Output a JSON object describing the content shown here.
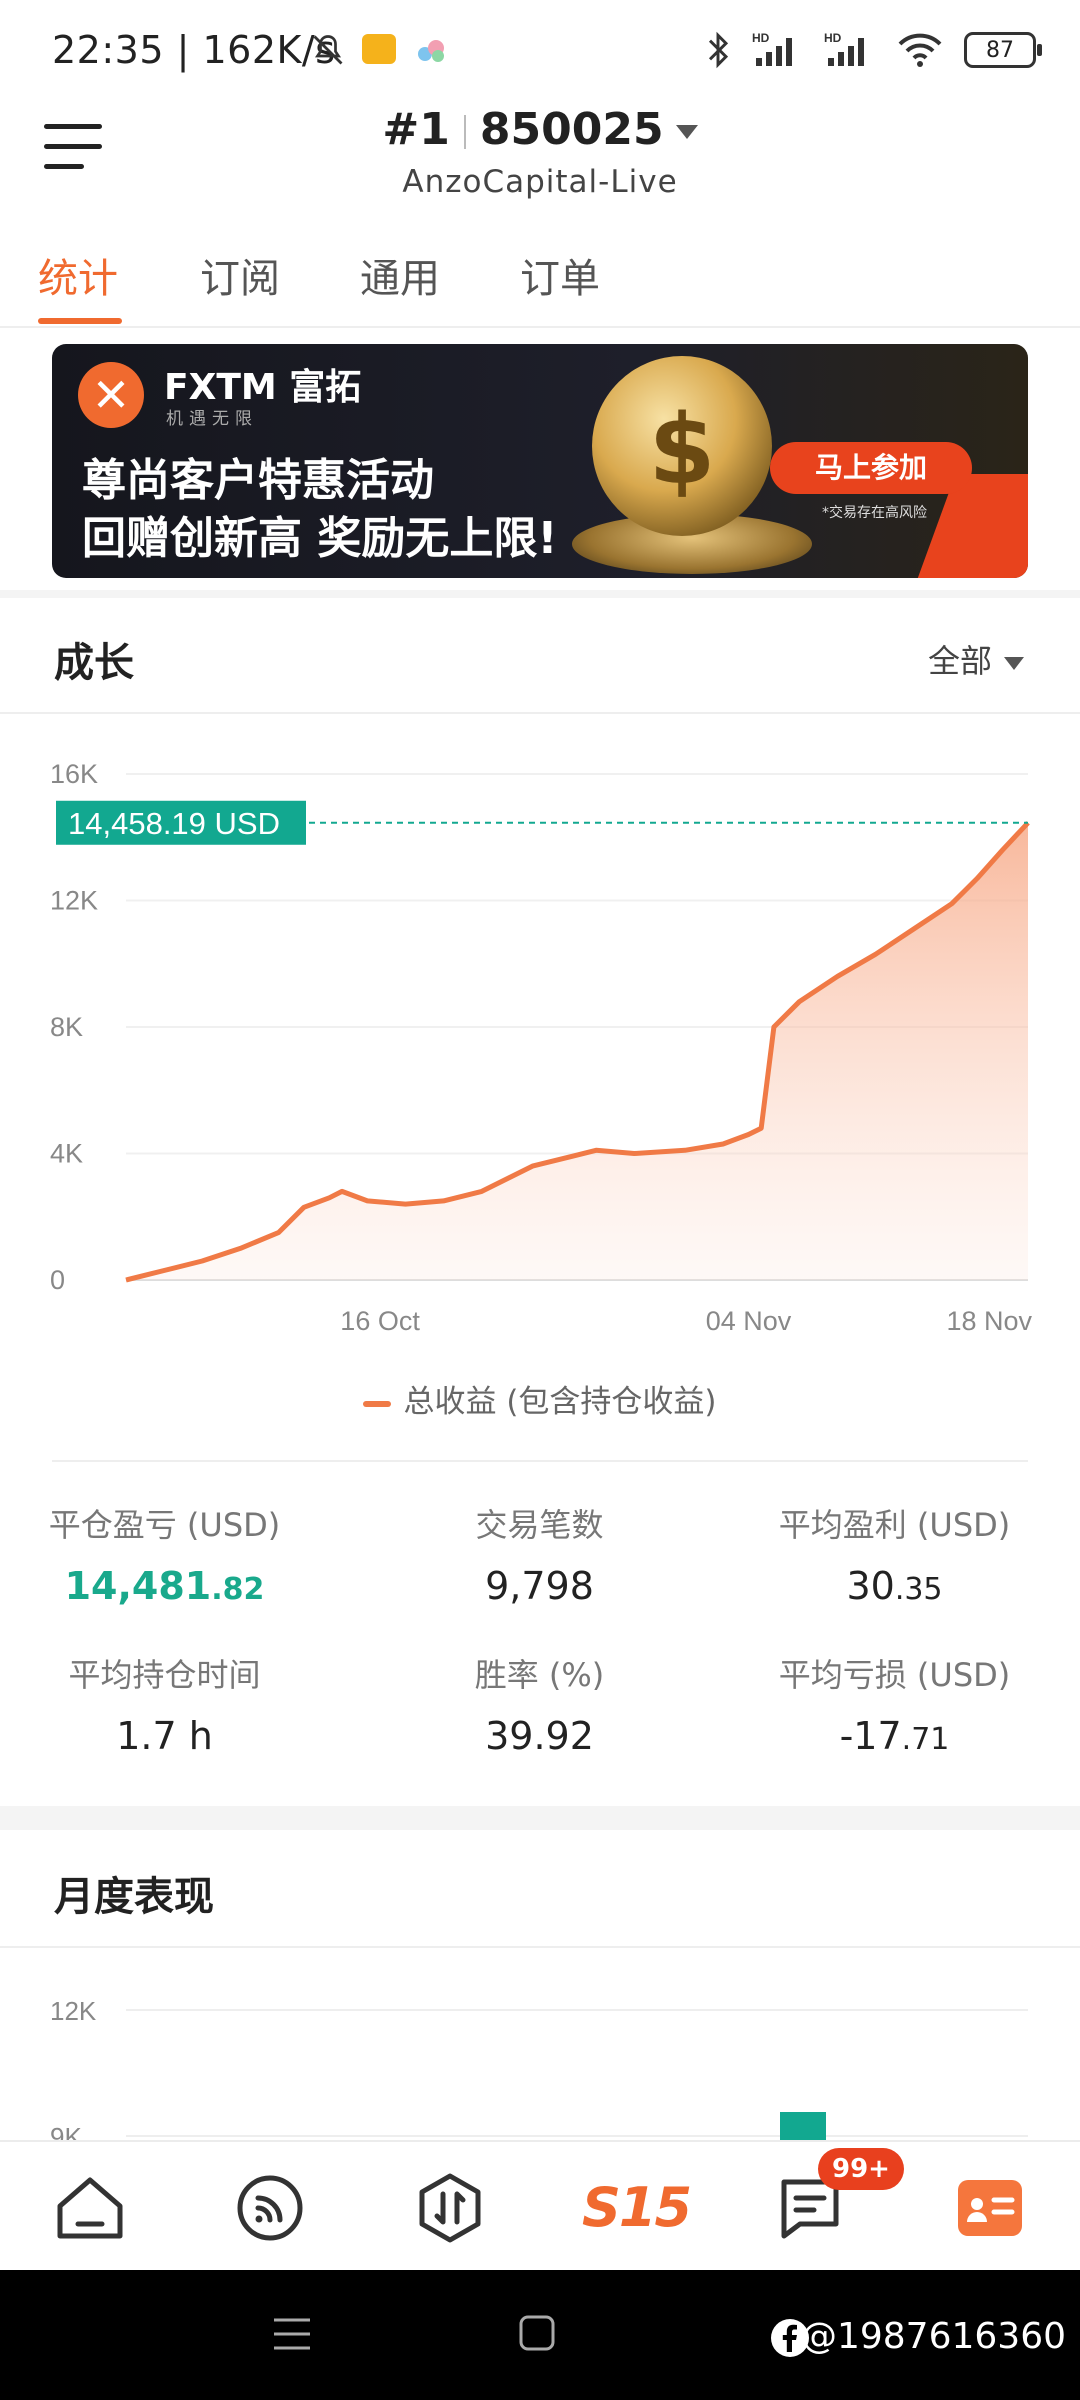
{
  "status_bar": {
    "time": "22:35 | 162K/s",
    "battery": "87"
  },
  "header": {
    "account_rank": "#1",
    "account_id": "850025",
    "server": "AnzoCapital-Live"
  },
  "tabs": [
    {
      "label": "统计",
      "active": true
    },
    {
      "label": "订阅",
      "active": false
    },
    {
      "label": "通用",
      "active": false
    },
    {
      "label": "订单",
      "active": false
    }
  ],
  "banner": {
    "brand": "FXTM 富拓",
    "tagline": "机遇无限",
    "line1": "尊尚客户特惠活动",
    "line2": "回赠创新高 奖励无上限!",
    "cta": "马上参加",
    "risk": "*交易存在高风险"
  },
  "growth": {
    "title": "成长",
    "filter": "全部",
    "current_value_label": "14,458.19 USD",
    "legend": "总收益 (包含持仓收益)"
  },
  "chart_data": [
    {
      "type": "area",
      "title": "成长",
      "series": [
        {
          "name": "总收益 (包含持仓收益)",
          "color": "#f07a46"
        }
      ],
      "x_tick_labels": [
        "16 Oct",
        "04 Nov",
        "18 Nov"
      ],
      "y_tick_labels": [
        "0",
        "4K",
        "8K",
        "12K",
        "16K"
      ],
      "ylim": [
        0,
        16000
      ],
      "points": [
        [
          0,
          0
        ],
        [
          3,
          300
        ],
        [
          6,
          600
        ],
        [
          9,
          1000
        ],
        [
          12,
          1500
        ],
        [
          14,
          2300
        ],
        [
          16,
          2600
        ],
        [
          17,
          2800
        ],
        [
          19,
          2500
        ],
        [
          22,
          2400
        ],
        [
          25,
          2500
        ],
        [
          28,
          2800
        ],
        [
          30,
          3200
        ],
        [
          32,
          3600
        ],
        [
          35,
          3900
        ],
        [
          37,
          4100
        ],
        [
          40,
          4000
        ],
        [
          44,
          4100
        ],
        [
          47,
          4300
        ],
        [
          49,
          4600
        ],
        [
          50,
          4800
        ],
        [
          51,
          8000
        ],
        [
          53,
          8800
        ],
        [
          56,
          9600
        ],
        [
          59,
          10300
        ],
        [
          62,
          11100
        ],
        [
          65,
          11900
        ],
        [
          67,
          12700
        ],
        [
          69,
          13600
        ],
        [
          71,
          14458.19
        ]
      ],
      "x_ticks_at": [
        20,
        49,
        66
      ],
      "x_max": 71,
      "current_value": 14458.19,
      "grid": true
    },
    {
      "type": "bar",
      "title": "月度表现",
      "y_tick_labels": [
        "12K",
        "9K"
      ],
      "bar_color": "#12a890"
    }
  ],
  "stats": [
    {
      "label": "平仓盈亏 (USD)",
      "int": "14,481",
      "dec": ".82",
      "green": true
    },
    {
      "label": "交易笔数",
      "int": "9,798",
      "dec": "",
      "green": false
    },
    {
      "label": "平均盈利 (USD)",
      "int": "30",
      "dec": ".35",
      "green": false
    },
    {
      "label": "平均持仓时间",
      "int": "1.7 h",
      "dec": "",
      "green": false
    },
    {
      "label": "胜率 (%)",
      "int": "39.92",
      "dec": "",
      "green": false
    },
    {
      "label": "平均亏损 (USD)",
      "int": "-17",
      "dec": ".71",
      "green": false
    }
  ],
  "monthly": {
    "title": "月度表现"
  },
  "bottom_nav": {
    "center_label": "S15",
    "badge": "99+"
  },
  "watermark": "@1987616360"
}
